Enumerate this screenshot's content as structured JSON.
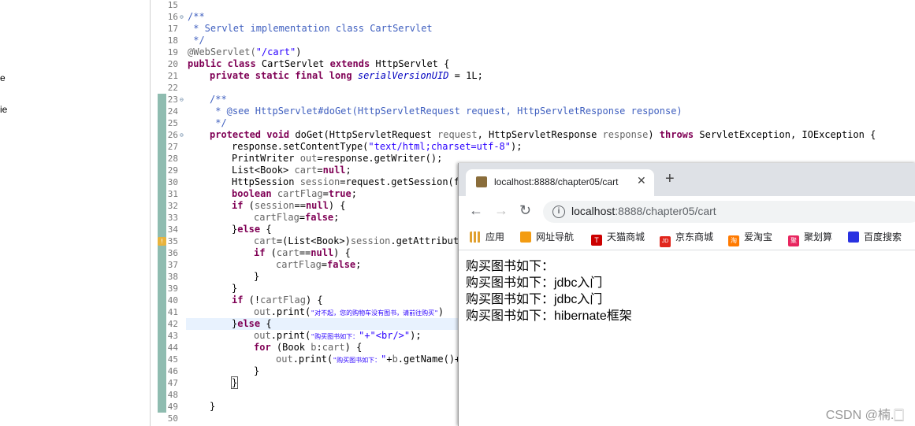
{
  "left_pane": {
    "fragments": [
      "e",
      "ie"
    ]
  },
  "editor": {
    "line_numbers": [
      "15",
      "16",
      "17",
      "18",
      "19",
      "20",
      "21",
      "22",
      "23",
      "24",
      "25",
      "26",
      "27",
      "28",
      "29",
      "30",
      "31",
      "32",
      "33",
      "34",
      "35",
      "36",
      "37",
      "38",
      "39",
      "40",
      "41",
      "42",
      "43",
      "44",
      "45",
      "46",
      "47",
      "48",
      "49",
      "50"
    ],
    "fold_markers": [
      "⊖",
      "⊖",
      "⊖"
    ],
    "warning_marker": "!",
    "lines": {
      "l16": "/**",
      "l17": " * Servlet implementation class CartServlet",
      "l18": " */",
      "l19_ann": "@WebServlet(",
      "l19_str": "\"/cart\"",
      "l19_end": ")",
      "l20_k1": "public class",
      "l20_t1": " CartServlet ",
      "l20_k2": "extends",
      "l20_t2": " HttpServlet {",
      "l21_k": "private static final long",
      "l21_f": "serialVersionUID",
      "l21_t": " = 1L;",
      "l23": "/**",
      "l24_a": " * @see ",
      "l24_b": "HttpServlet#doGet(HttpServletRequest request, HttpServletResponse response)",
      "l25": " */",
      "l26_k1": "protected void",
      "l26_t1": " doGet(HttpServletRequest ",
      "l26_p1": "request",
      "l26_t2": ", HttpServletResponse ",
      "l26_p2": "response",
      "l26_t3": ") ",
      "l26_k2": "throws",
      "l26_t4": " ServletException, IOException {",
      "l27_t1": "response.setContentType(",
      "l27_s": "\"text/html;charset=utf-8\"",
      "l27_t2": ");",
      "l28_t1": "PrintWriter ",
      "l28_v": "out",
      "l28_t2": "=response.getWriter();",
      "l29_t1": "List<Book> ",
      "l29_v": "cart",
      "l29_t2": "=",
      "l29_k": "null",
      "l29_t3": ";",
      "l30_t1": "HttpSession ",
      "l30_v": "session",
      "l30_t2": "=request.getSession(fa",
      "l31_k1": "boolean",
      "l31_t1": " ",
      "l31_v": "cartFlag",
      "l31_t2": "=",
      "l31_k2": "true",
      "l31_t3": ";",
      "l32_k1": "if",
      "l32_t1": " (",
      "l32_v": "session",
      "l32_t2": "==",
      "l32_k2": "null",
      "l32_t3": ") {",
      "l33_v": "cartFlag",
      "l33_t1": "=",
      "l33_k": "false",
      "l33_t2": ";",
      "l34_t1": "}",
      "l34_k": "else",
      "l34_t2": " {",
      "l35_v": "cart",
      "l35_t1": "=(List<Book>)",
      "l35_v2": "session",
      "l35_t2": ".getAttribute",
      "l36_k1": "if",
      "l36_t1": " (",
      "l36_v": "cart",
      "l36_t2": "==",
      "l36_k2": "null",
      "l36_t3": ") {",
      "l37_v": "cartFlag",
      "l37_t1": "=",
      "l37_k": "false",
      "l37_t2": ";",
      "l38": "}",
      "l39": "}",
      "l40_k": "if",
      "l40_t1": " (!",
      "l40_v": "cartFlag",
      "l40_t2": ") {",
      "l41_v": "out",
      "l41_t1": ".print(",
      "l41_s": "\"对不起，您的购物车没有图书，请前往购买\"",
      "l41_t2": ")",
      "l42_t1": "}",
      "l42_k": "else",
      "l42_t2": " {",
      "l43_v": "out",
      "l43_t1": ".print(",
      "l43_s1": "\"购买图书如下：",
      "l43_s2": "\"+\"<br/>\"",
      "l43_t2": ");",
      "l44_k": "for",
      "l44_t1": " (Book ",
      "l44_v": "b",
      "l44_t2": ":",
      "l44_v2": "cart",
      "l44_t3": ") {",
      "l45_v": "out",
      "l45_t1": ".print(",
      "l45_s1": "\"购买图书如下：",
      "l45_s2": "\"",
      "l45_t2": "+",
      "l45_v2": "b",
      "l45_t3": ".getName()+",
      "l46": "}",
      "l47": "}",
      "l49": "}"
    }
  },
  "browser": {
    "tab_title": "localhost:8888/chapter05/cart",
    "tab_close": "✕",
    "new_tab": "+",
    "nav": {
      "back": "←",
      "forward": "→",
      "reload": "↻"
    },
    "info_icon": "i",
    "url_host": "localhost",
    "url_rest": ":8888/chapter05/cart",
    "bookmarks": [
      {
        "label": "应用",
        "color": "#e0a030"
      },
      {
        "label": "网址导航",
        "color": "#f39c12"
      },
      {
        "label": "天猫商城",
        "color": "#cc0000"
      },
      {
        "label": "京东商城",
        "color": "#e1251b"
      },
      {
        "label": "爱淘宝",
        "color": "#ff7a00"
      },
      {
        "label": "聚划算",
        "color": "#e8265f"
      },
      {
        "label": "百度搜索",
        "color": "#2932e1"
      }
    ],
    "bookmark_icon_glyphs": [
      "",
      "",
      "T",
      "JD",
      "淘",
      "聚",
      ""
    ],
    "content_lines": [
      "购买图书如下：",
      "购买图书如下：jdbc入门",
      "购买图书如下：jdbc入门",
      "购买图书如下：hibernate框架"
    ]
  },
  "watermark": "CSDN @楠.🀆"
}
